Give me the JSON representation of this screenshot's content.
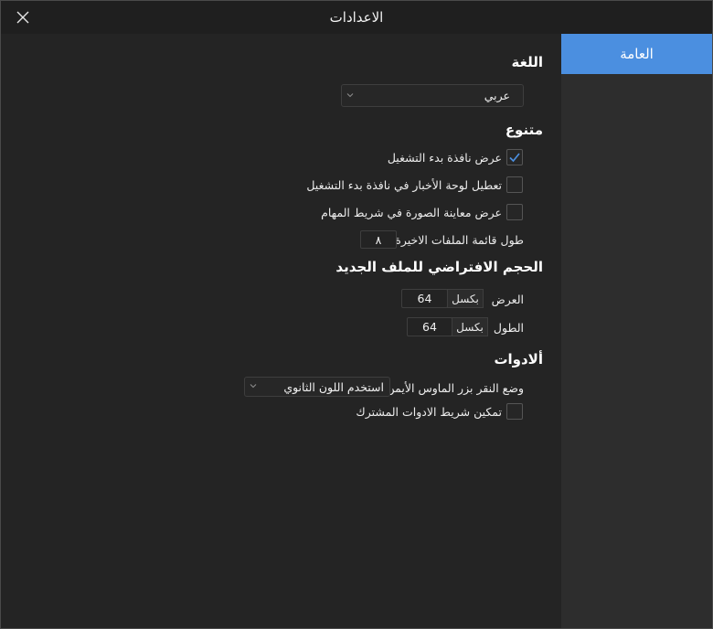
{
  "window": {
    "title": "الاعدادات"
  },
  "sidebar": {
    "items": [
      {
        "label": "العامة",
        "selected": true
      }
    ]
  },
  "language": {
    "heading": "اللغة",
    "selected": "عربي"
  },
  "misc": {
    "heading": "متنوع",
    "show_startup_window": {
      "label": "عرض نافذة بدء التشغيل",
      "checked": true
    },
    "disable_news_panel": {
      "label": "تعطيل لوحة الأخبار في نافذة بدء التشغيل",
      "checked": false
    },
    "taskbar_preview": {
      "label": "عرض معاينة الصورة في شريط المهام",
      "checked": false
    },
    "recent_files": {
      "label": "طول قائمة الملفات الاخيرة",
      "value": "٨"
    }
  },
  "default_size": {
    "heading": "الحجم الافتراضي للملف الجديد",
    "width": {
      "label": "العرض",
      "unit": "بكسل",
      "value": "64"
    },
    "height": {
      "label": "الطول",
      "unit": "بكسل",
      "value": "64"
    }
  },
  "tools": {
    "heading": "ألادوات",
    "right_click": {
      "label": "وضع النقر بزر الماوس الأيمن",
      "selected": "استخدم اللون الثانوي"
    },
    "shared_toolbar": {
      "label": "تمكين شريط الادوات المشترك",
      "checked": false
    }
  },
  "colors": {
    "accent": "#4b8fe0",
    "background": "#242424",
    "sidebar": "#2d2d2d"
  }
}
